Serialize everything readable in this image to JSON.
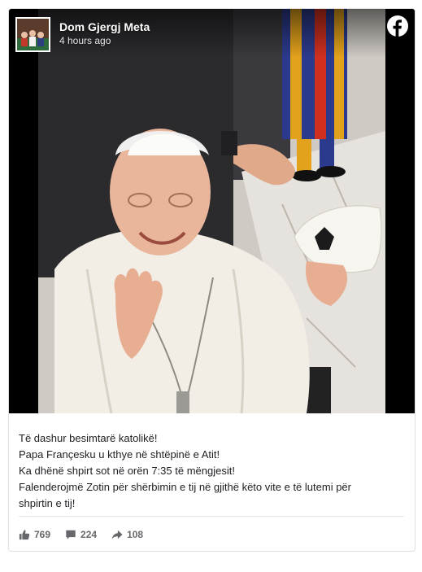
{
  "post": {
    "author": "Dom Gjergj Meta",
    "timestamp": "4 hours ago",
    "caption_lines": [
      "Të dashur besimtarë katolikë!",
      "Papa Françesku u kthye në shtëpinë e Atit!",
      "Ka dhënë shpirt sot në orën 7:35 të mëngjesit!",
      "Falenderojmë Zotin për shërbimin e tij në gjithë këto vite e të lutemi për",
      "shpirtin e tij!"
    ]
  },
  "stats": {
    "likes": "769",
    "comments": "224",
    "shares": "108"
  },
  "icons": {
    "brand": "facebook-icon",
    "like": "thumbs-up-icon",
    "comment": "comment-icon",
    "share": "share-arrow-icon"
  },
  "colors": {
    "brand": "#1877f2",
    "icon_gray": "#65676b",
    "text": "#1c1e21"
  }
}
